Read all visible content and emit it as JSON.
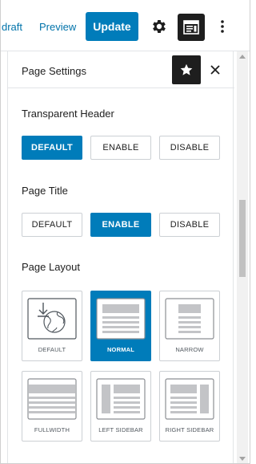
{
  "toolbar": {
    "save_draft": "draft",
    "preview": "Preview",
    "update": "Update"
  },
  "panel": {
    "title": "Page Settings"
  },
  "transparent_header": {
    "label": "Transparent Header",
    "options": [
      "DEFAULT",
      "ENABLE",
      "DISABLE"
    ],
    "selected": "DEFAULT"
  },
  "page_title": {
    "label": "Page Title",
    "options": [
      "DEFAULT",
      "ENABLE",
      "DISABLE"
    ],
    "selected": "ENABLE"
  },
  "page_layout": {
    "label": "Page Layout",
    "options": [
      "DEFAULT",
      "NORMAL",
      "NARROW",
      "FULLWIDTH",
      "LEFT SIDEBAR",
      "RIGHT SIDEBAR"
    ],
    "selected": "NORMAL"
  },
  "icons": {
    "settings": "gear-icon",
    "astra": "astra-settings-icon",
    "more": "more-vertical-icon",
    "pin": "star-icon",
    "close": "close-icon"
  },
  "colors": {
    "accent": "#007cba",
    "dark": "#1e1e1e",
    "border": "#ccd0d4"
  }
}
